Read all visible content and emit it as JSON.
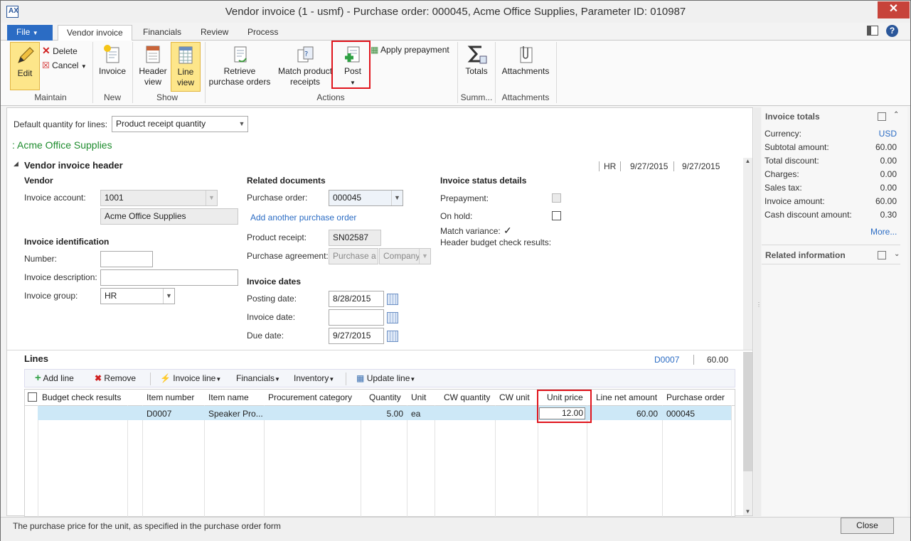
{
  "window": {
    "title": "Vendor invoice (1 - usmf) - Purchase order: 000045, Acme Office Supplies, Parameter ID: 010987",
    "minimize": "—",
    "maximize": "□",
    "close": "✕"
  },
  "tabs": [
    {
      "label": "File"
    },
    {
      "label": "Vendor invoice"
    },
    {
      "label": "Financials"
    },
    {
      "label": "Review"
    },
    {
      "label": "Process"
    }
  ],
  "ribbon": {
    "maintain": {
      "edit": "Edit",
      "delete": "Delete",
      "cancel": "Cancel",
      "group": "Maintain"
    },
    "new": {
      "invoice": "Invoice",
      "group": "New"
    },
    "show": {
      "header_view_1": "Header",
      "header_view_2": "view",
      "line_view_1": "Line",
      "line_view_2": "view",
      "group": "Show"
    },
    "actions": {
      "retrieve_1": "Retrieve",
      "retrieve_2": "purchase orders",
      "match_1": "Match product",
      "match_2": "receipts",
      "post": "Post",
      "apply_prepayment": "Apply prepayment",
      "group": "Actions"
    },
    "summary": {
      "totals": "Totals",
      "group": "Summ..."
    },
    "attachments": {
      "attachments": "Attachments",
      "group": "Attachments"
    }
  },
  "form": {
    "default_qty_label": "Default quantity for lines:",
    "default_qty_value": "Product receipt quantity",
    "vendor_caption": ": Acme Office Supplies",
    "header_title": "Vendor invoice header",
    "header_summary": {
      "group": "HR",
      "date1": "9/27/2015",
      "date2": "9/27/2015"
    },
    "vendor": {
      "title": "Vendor",
      "invoice_account_label": "Invoice account:",
      "invoice_account": "1001",
      "vendor_name": "Acme Office Supplies"
    },
    "identification": {
      "title": "Invoice identification",
      "number_label": "Number:",
      "number": "",
      "description_label": "Invoice description:",
      "description": "",
      "group_label": "Invoice group:",
      "group": "HR"
    },
    "related": {
      "title": "Related documents",
      "po_label": "Purchase order:",
      "po": "000045",
      "add_po_link": "Add another purchase order",
      "receipt_label": "Product receipt:",
      "receipt": "SN02587",
      "agreement_label": "Purchase agreement:",
      "agreement_1": "Purchase a",
      "agreement_2": "Company"
    },
    "dates": {
      "title": "Invoice dates",
      "posting_label": "Posting date:",
      "posting": "8/28/2015",
      "invoice_label": "Invoice date:",
      "invoice": "",
      "due_label": "Due date:",
      "due": "9/27/2015"
    },
    "status": {
      "title": "Invoice status details",
      "prepayment_label": "Prepayment:",
      "onhold_label": "On hold:",
      "match_variance_label": "Match variance:",
      "budget_check_label": "Header budget check results:"
    }
  },
  "lines": {
    "title": "Lines",
    "summary_item": "D0007",
    "summary_amount": "60.00",
    "toolbar": {
      "add_line": "Add line",
      "remove": "Remove",
      "invoice_line": "Invoice line",
      "financials": "Financials",
      "inventory": "Inventory",
      "update_line": "Update line"
    },
    "columns": [
      "Budget check results",
      "Item number",
      "Item name",
      "Procurement category",
      "Quantity",
      "Unit",
      "CW quantity",
      "CW unit",
      "Unit price",
      "Line net amount",
      "Purchase order"
    ],
    "rows": [
      {
        "budget": "",
        "item_number": "D0007",
        "item_name": "Speaker Pro...",
        "category": "",
        "quantity": "5.00",
        "unit": "ea",
        "cw_quantity": "",
        "cw_unit": "",
        "unit_price": "12.00",
        "line_net_amount": "60.00",
        "purchase_order": "000045"
      }
    ]
  },
  "totals": {
    "title": "Invoice totals",
    "currency_label": "Currency:",
    "currency": "USD",
    "subtotal_label": "Subtotal amount:",
    "subtotal": "60.00",
    "discount_label": "Total discount:",
    "discount": "0.00",
    "charges_label": "Charges:",
    "charges": "0.00",
    "tax_label": "Sales tax:",
    "tax": "0.00",
    "invoice_amount_label": "Invoice amount:",
    "invoice_amount": "60.00",
    "cash_discount_label": "Cash discount amount:",
    "cash_discount": "0.30",
    "more": "More..."
  },
  "related_info": {
    "title": "Related information"
  },
  "status_bar": {
    "text": "The purchase price for the unit, as specified in the purchase order form",
    "close": "Close"
  },
  "colors": {
    "accent": "#2b6cc4",
    "highlight": "#e0141c",
    "selected_row": "#cde8f7",
    "vendor_caption": "#1e8c2e"
  }
}
